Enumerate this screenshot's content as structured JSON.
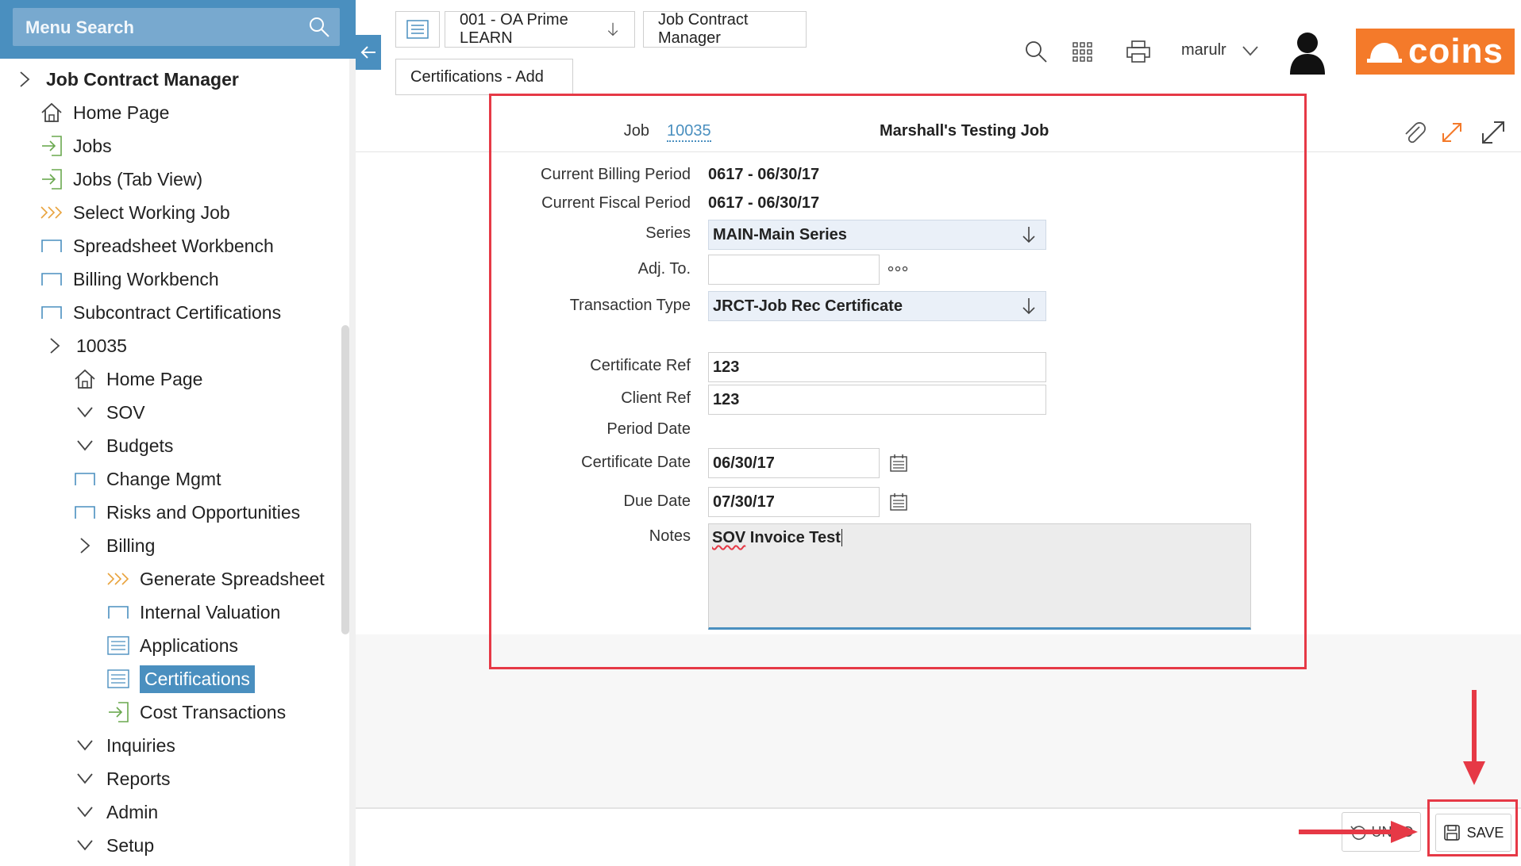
{
  "sidebar": {
    "search_placeholder": "Menu Search",
    "items": [
      {
        "label": "Job Contract Manager",
        "icon": "chevron-right-icon"
      },
      {
        "label": "Home Page",
        "icon": "home-icon"
      },
      {
        "label": "Jobs",
        "icon": "enter-arrow-icon"
      },
      {
        "label": "Jobs (Tab View)",
        "icon": "enter-arrow-icon"
      },
      {
        "label": "Select Working Job",
        "icon": "chevrons-right-icon"
      },
      {
        "label": "Spreadsheet Workbench",
        "icon": "window-icon"
      },
      {
        "label": "Billing Workbench",
        "icon": "window-icon"
      },
      {
        "label": "Subcontract Certifications",
        "icon": "window-icon"
      },
      {
        "label": "10035",
        "icon": "chevron-right-icon"
      },
      {
        "label": "Home Page",
        "icon": "home-icon"
      },
      {
        "label": "SOV",
        "icon": "chevron-down-icon"
      },
      {
        "label": "Budgets",
        "icon": "chevron-down-icon"
      },
      {
        "label": "Change Mgmt",
        "icon": "window-icon"
      },
      {
        "label": "Risks and Opportunities",
        "icon": "window-icon"
      },
      {
        "label": "Billing",
        "icon": "chevron-right-icon"
      },
      {
        "label": "Generate Spreadsheet",
        "icon": "chevrons-right-icon"
      },
      {
        "label": "Internal Valuation",
        "icon": "window-icon"
      },
      {
        "label": "Applications",
        "icon": "list-icon"
      },
      {
        "label": "Certifications",
        "icon": "list-icon"
      },
      {
        "label": "Cost Transactions",
        "icon": "enter-arrow-icon"
      },
      {
        "label": "Inquiries",
        "icon": "chevron-down-icon"
      },
      {
        "label": "Reports",
        "icon": "chevron-down-icon"
      },
      {
        "label": "Admin",
        "icon": "chevron-down-icon"
      },
      {
        "label": "Setup",
        "icon": "chevron-down-icon"
      }
    ]
  },
  "breadcrumb": {
    "company": "001 - OA Prime LEARN",
    "module": "Job Contract Manager",
    "page": "Certifications - Add"
  },
  "header": {
    "user": "marulr",
    "logo_text": "coins"
  },
  "form": {
    "job_label": "Job",
    "job_number": "10035",
    "job_name": "Marshall's Testing Job",
    "billing_period_label": "Current Billing Period",
    "billing_period": "0617 - 06/30/17",
    "fiscal_period_label": "Current Fiscal Period",
    "fiscal_period": "0617 - 06/30/17",
    "series_label": "Series",
    "series": "MAIN-Main Series",
    "adj_to_label": "Adj. To.",
    "adj_to": "",
    "transaction_type_label": "Transaction Type",
    "transaction_type": "JRCT-Job Rec Certificate",
    "certificate_ref_label": "Certificate Ref",
    "certificate_ref": "123",
    "client_ref_label": "Client Ref",
    "client_ref": "123",
    "period_date_label": "Period Date",
    "certificate_date_label": "Certificate Date",
    "certificate_date": "06/30/17",
    "due_date_label": "Due Date",
    "due_date": "07/30/17",
    "notes_label": "Notes",
    "notes_word1": "SOV",
    "notes_rest": " Invoice Test"
  },
  "footer": {
    "undo_label": "UNDO",
    "save_label": "SAVE"
  },
  "colors": {
    "accent": "#4a8fbf",
    "brand": "#f47a2a",
    "highlight": "#e63946"
  }
}
